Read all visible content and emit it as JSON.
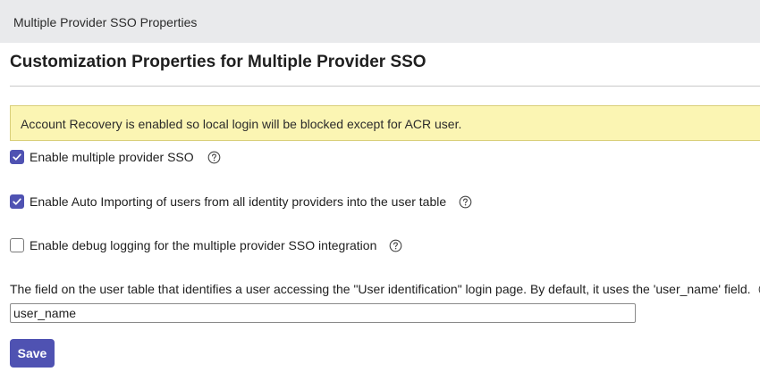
{
  "header": {
    "title": "Multiple Provider SSO Properties"
  },
  "page": {
    "title": "Customization Properties for Multiple Provider SSO"
  },
  "alert": {
    "text": "Account Recovery is enabled so local login will be blocked except for ACR user."
  },
  "options": [
    {
      "label": "Enable multiple provider SSO",
      "checked": true
    },
    {
      "label": "Enable Auto Importing of users from all identity providers into the user table",
      "checked": true
    },
    {
      "label": "Enable debug logging for the multiple provider SSO integration",
      "checked": false
    }
  ],
  "user_field": {
    "label": "The field on the user table that identifies a user accessing the \"User identification\" login page. By default, it uses the 'user_name' field.",
    "value": "user_name"
  },
  "actions": {
    "save_label": "Save"
  },
  "colors": {
    "accent": "#4f52b2",
    "alert_background": "#fbf5b3",
    "header_background": "#e9eaec"
  },
  "icons": {
    "help": "help-circle-icon",
    "check": "checkmark-icon"
  }
}
